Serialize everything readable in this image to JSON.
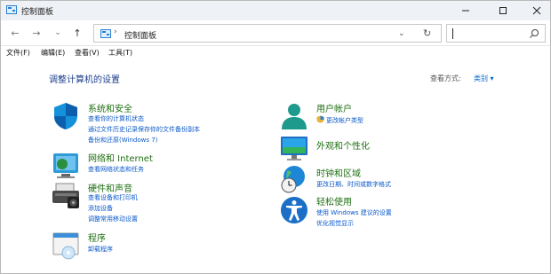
{
  "window": {
    "title": "控制面板"
  },
  "address": {
    "current": "控制面板"
  },
  "search": {
    "placeholder": ""
  },
  "menu": {
    "items": [
      "文件(F)",
      "编辑(E)",
      "查看(V)",
      "工具(T)"
    ]
  },
  "main": {
    "heading": "调整计算机的设置",
    "view_by_label": "查看方式:",
    "view_by_value": "类别 ▾",
    "categories": [
      {
        "title": "系统和安全",
        "links": [
          "查看你的计算机状态",
          "通过文件历史记录保存你的文件备份副本",
          "备份和还原(Windows 7)"
        ]
      },
      {
        "title": "网络和 Internet",
        "links": [
          "查看网络状态和任务"
        ]
      },
      {
        "title": "硬件和声音",
        "links": [
          "查看设备和打印机",
          "添加设备",
          "调整常用移动设置"
        ]
      },
      {
        "title": "程序",
        "links": [
          "卸载程序"
        ]
      },
      {
        "title": "用户帐户",
        "links": [
          "更改帐户类型"
        ]
      },
      {
        "title": "外观和个性化",
        "links": []
      },
      {
        "title": "时钟和区域",
        "links": [
          "更改日期、时间或数字格式"
        ]
      },
      {
        "title": "轻松使用",
        "links": [
          "使用 Windows 建议的设置",
          "优化视觉显示"
        ]
      }
    ]
  }
}
